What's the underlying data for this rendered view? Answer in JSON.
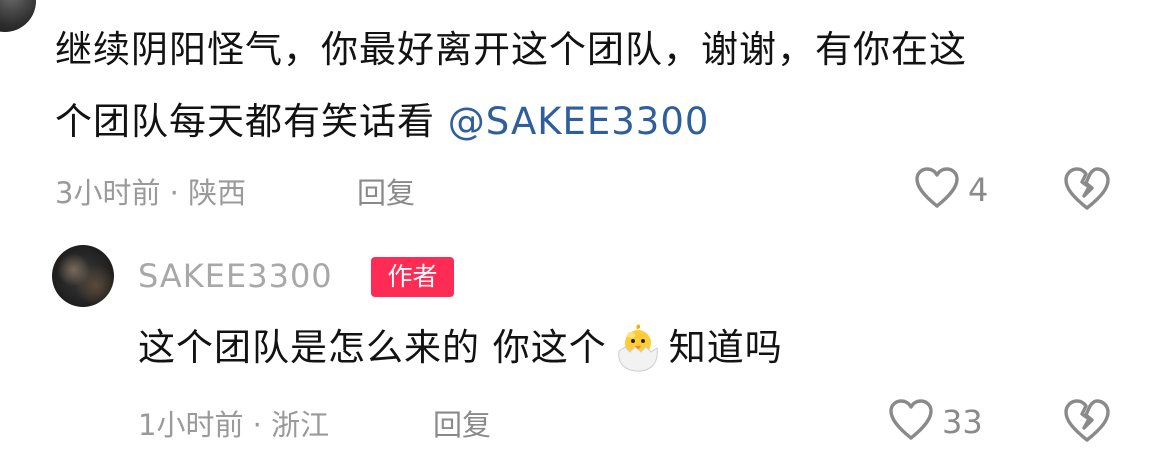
{
  "top_comment": {
    "text_line1": "继续阴阳怪气，你最好离开这个团队，谢谢，有你在这",
    "text_line2": "个团队每天都有笑话看",
    "mention": "@SAKEE3300",
    "meta": "3小时前 · 陕西",
    "reply_label": "回复",
    "like_count": "4"
  },
  "reply": {
    "username": "SAKEE3300",
    "badge": "作者",
    "text_before_emoji": "这个团队是怎么来的 你这个",
    "emoji": "hatching-chick-emoji",
    "text_after_emoji": "知道吗",
    "meta": "1小时前 · 浙江",
    "reply_label": "回复",
    "like_count": "33"
  },
  "colors": {
    "mention": "#2f5f9a",
    "badge_bg": "#fe2c55",
    "muted": "#9a9a9a"
  },
  "icons": {
    "like": "heart-outline-icon",
    "dislike": "broken-heart-icon"
  }
}
